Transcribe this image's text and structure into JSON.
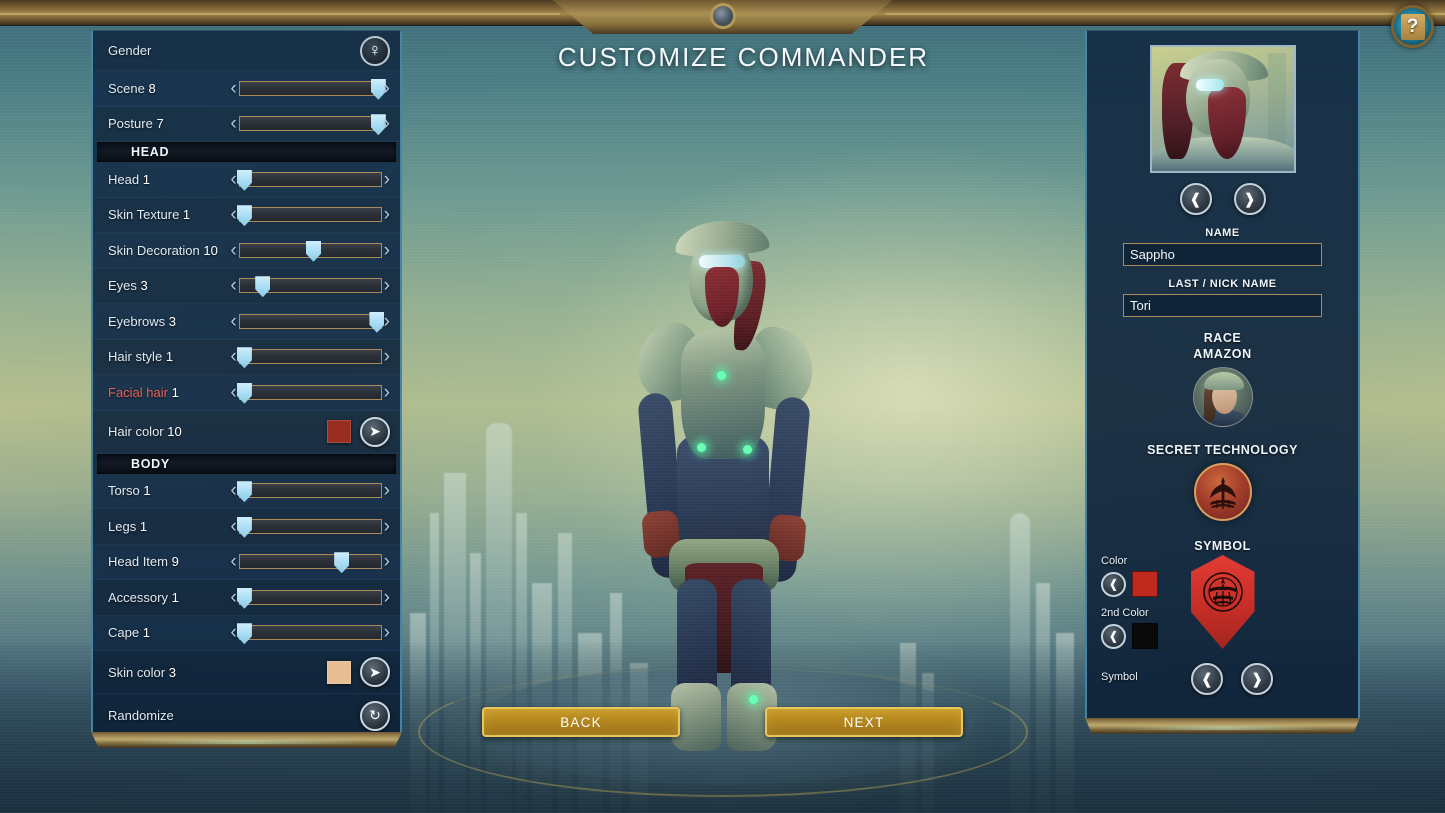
{
  "page": {
    "title": "CUSTOMIZE COMMANDER",
    "help_icon": "question-mark-icon",
    "accent_gold": "#c79a27",
    "accent_blue": "#5ca8ce",
    "panel_bg": "#122a42"
  },
  "left_panel": {
    "gender": {
      "label": "Gender",
      "icon": "female-gender-icon"
    },
    "top_rows": [
      {
        "label": "Scene",
        "value": "8",
        "slider_pct": 98
      },
      {
        "label": "Posture",
        "value": "7",
        "slider_pct": 98
      }
    ],
    "sections": [
      {
        "title": "HEAD",
        "rows": [
          {
            "label": "Head",
            "value": "1",
            "slider_pct": 3,
            "type": "slider"
          },
          {
            "label": "Skin Texture",
            "value": "1",
            "slider_pct": 3,
            "type": "slider"
          },
          {
            "label": "Skin Decoration",
            "value": "10",
            "slider_pct": 52,
            "type": "slider"
          },
          {
            "label": "Eyes",
            "value": "3",
            "slider_pct": 16,
            "type": "slider"
          },
          {
            "label": "Eyebrows",
            "value": "3",
            "slider_pct": 97,
            "type": "slider"
          },
          {
            "label": "Hair style",
            "value": "1",
            "slider_pct": 3,
            "type": "slider"
          },
          {
            "label": "Facial hair",
            "value": "1",
            "slider_pct": 3,
            "type": "slider",
            "highlight": "red"
          },
          {
            "label": "Hair color",
            "value": "10",
            "type": "color",
            "color": "#9a2d22"
          }
        ]
      },
      {
        "title": "BODY",
        "rows": [
          {
            "label": "Torso",
            "value": "1",
            "slider_pct": 3,
            "type": "slider"
          },
          {
            "label": "Legs",
            "value": "1",
            "slider_pct": 3,
            "type": "slider"
          },
          {
            "label": "Head Item",
            "value": "9",
            "slider_pct": 72,
            "type": "slider"
          },
          {
            "label": "Accessory",
            "value": "1",
            "slider_pct": 3,
            "type": "slider"
          },
          {
            "label": "Cape",
            "value": "1",
            "slider_pct": 3,
            "type": "slider"
          },
          {
            "label": "Skin color",
            "value": "3",
            "type": "color",
            "color": "#e8be93"
          }
        ]
      }
    ],
    "randomize": {
      "label": "Randomize",
      "icon": "refresh-icon"
    }
  },
  "right_panel": {
    "portrait_prev_icon": "chevron-left-icon",
    "portrait_next_icon": "chevron-right-icon",
    "name_label": "NAME",
    "name_value": "Sappho",
    "nick_label": "LAST / NICK NAME",
    "nick_value": "Tori",
    "race_label": "RACE",
    "race_value": "AMAZON",
    "tech_label": "SECRET TECHNOLOGY",
    "symbol_label": "SYMBOL",
    "color_label": "Color",
    "color_value": "#c0291e",
    "color2_label": "2nd Color",
    "color2_value": "#0a0a0a",
    "symbol_control_label": "Symbol"
  },
  "footer": {
    "back_label": "BACK",
    "next_label": "NEXT"
  }
}
